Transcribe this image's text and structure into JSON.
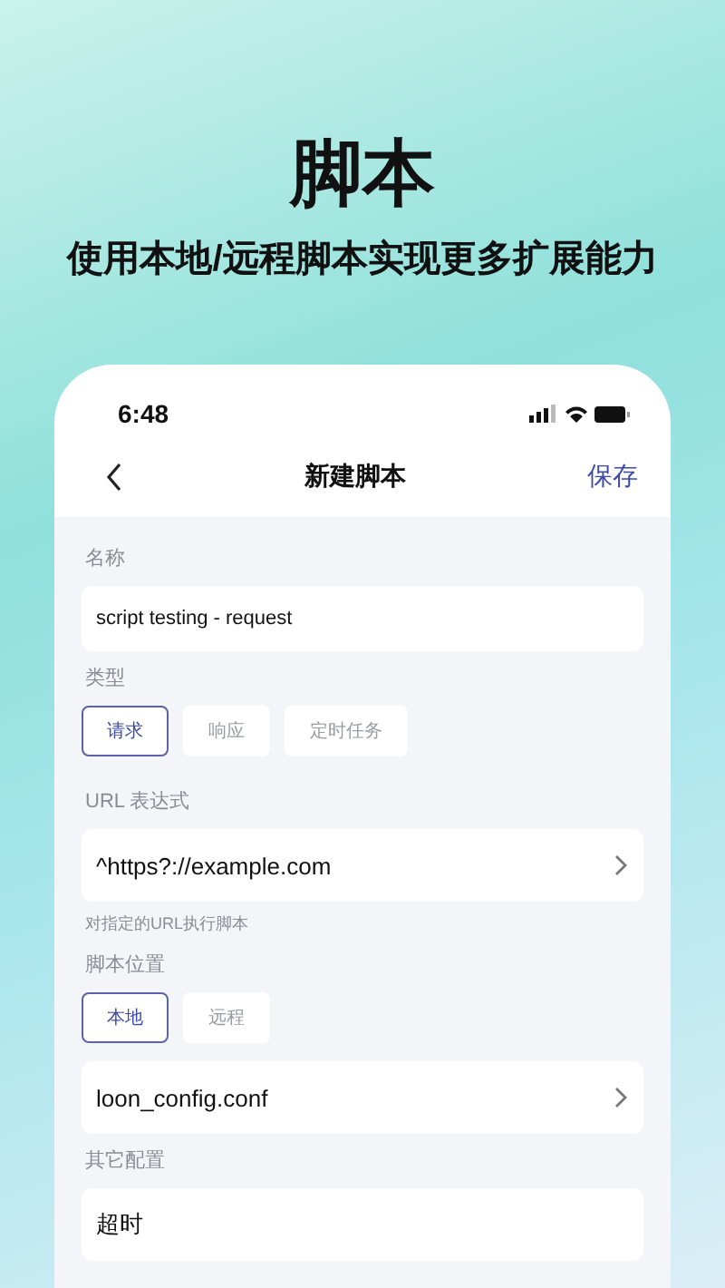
{
  "headline": {
    "title": "脚本",
    "subtitle": "使用本地/远程脚本实现更多扩展能力"
  },
  "status_bar": {
    "time": "6:48"
  },
  "nav_bar": {
    "title": "新建脚本",
    "action": "保存"
  },
  "sections": [
    {
      "kind": "text",
      "label": "名称",
      "value": "script testing - request"
    },
    {
      "kind": "segments",
      "label": "类型",
      "options": [
        {
          "label": "请求",
          "selected": true
        },
        {
          "label": "响应",
          "selected": false
        },
        {
          "label": "定时任务",
          "selected": false
        }
      ]
    },
    {
      "kind": "link",
      "label": "URL 表达式",
      "value": "^https?://example.com",
      "hint": "对指定的URL执行脚本"
    },
    {
      "kind": "segments",
      "label": "脚本位置",
      "options": [
        {
          "label": "本地",
          "selected": true
        },
        {
          "label": "远程",
          "selected": false
        }
      ]
    },
    {
      "kind": "link",
      "value": "loon_config.conf"
    },
    {
      "kind": "rows",
      "label": "其它配置",
      "rows": [
        {
          "label": "超时"
        }
      ]
    }
  ]
}
